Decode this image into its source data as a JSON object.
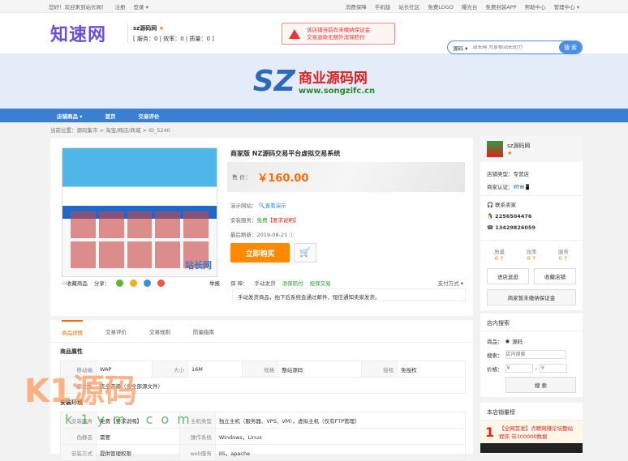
{
  "topbar": {
    "welcome": "您好！欢迎来到站长网！",
    "register": "注册",
    "login": "登录 ▾",
    "links": [
      "消费保障",
      "手机版",
      "站长社区",
      "免费LOGO",
      "曝光台",
      "免费封装APP",
      "帮助中心",
      "管理中心 ▾"
    ]
  },
  "header": {
    "logo": "知速网",
    "shop_name": "sz源码网",
    "stats": "[ 服务：0 | 效率：0 | 质量：0 ]",
    "warning_line1": "该店铺当前尚未缴纳保证金",
    "warning_line2": "交易退款无额外消保赔付",
    "search_category": "源码 ▾",
    "search_placeholder": "站长网 为草根站长助力",
    "search_button": "搜 索"
  },
  "banner": {
    "logo_text": "商业源码网",
    "logo_url": "www.songzifc.cn",
    "logo_mark": "SZ"
  },
  "nav": {
    "items": [
      "店铺商品 ▾",
      "首页",
      "交易评价"
    ]
  },
  "breadcrumb": "当前位置：源码集市 > 淘宝/网店/商城 > ID_5240",
  "product": {
    "title": "商家版 NZ源码交易平台虚拟交易系统",
    "price_label": "售 价：",
    "price": "￥160.00",
    "demo_label": "演示网站：",
    "demo_link": "查看演示",
    "install_label": "安装服务：",
    "install_value": "免费",
    "install_note": "【要求说明】",
    "refresh_label": "最后刷新：",
    "refresh_date": "2019-08-21",
    "buy": "立即购买",
    "guarantee_label": "保 障：",
    "guarantees": [
      "手动发货",
      "消保赔付",
      "担保交易"
    ],
    "pay_methods": "支付方式 ▾",
    "guarantee_note": "手动发货商品，拍下后系统会通过邮件、短信通知卖家发货。",
    "favorite": "收藏商品",
    "share": "分享：",
    "report": "举报",
    "thumb_watermark": "站长网"
  },
  "seller": {
    "name": "sz源码网",
    "type": "店铺类型：专营店",
    "cert": "商家认证：",
    "contact": "联系卖家",
    "qq": "2256504476",
    "phone": "13429826059",
    "stats": [
      {
        "label": "质量",
        "value": "0 ↑"
      },
      {
        "label": "效率",
        "value": "0 ↑"
      },
      {
        "label": "服务",
        "value": "0 ↑"
      }
    ],
    "enter": "进店逛逛",
    "collect": "收藏店铺",
    "deposit": "商家暂未缴纳保证金"
  },
  "shop_search": {
    "title": "店内搜索",
    "goods_label": "商品：",
    "goods_value": "源码",
    "search_label": "搜索：",
    "search_placeholder": "店内搜索",
    "price_label": "价格：",
    "price_from": "￥",
    "price_to": "￥",
    "button": "搜 索"
  },
  "ranking": {
    "title": "本店销量榜",
    "rank": "1",
    "item": "【全网首发】点睛网赚论坛整站程序 带100000数据"
  },
  "details": {
    "tabs": [
      "商品详情",
      "交易评价",
      "交易规则",
      "防骗指南"
    ],
    "attr_title": "商品属性",
    "attrs": [
      [
        "移动端",
        "WAP",
        "大小",
        "16M",
        "规格",
        "整站源码",
        "授权",
        "免授权"
      ],
      [
        "源文件",
        "完全开源（含全部源文件）"
      ]
    ],
    "env_title": "安装环境",
    "env": [
      [
        "安装服务",
        "免费【要求说明】",
        "主机类型",
        "独立主机（服务器、VPS、VM），虚拟主机（仅有FTP管理）"
      ],
      [
        "伪静态",
        "需要",
        "操作系统",
        "Windows，Linux"
      ],
      [
        "安装方式",
        "提供管理权限",
        "web服务",
        "IIS，apache"
      ]
    ]
  },
  "watermark": {
    "text": "K1源码",
    "url": "k1ym.com"
  }
}
